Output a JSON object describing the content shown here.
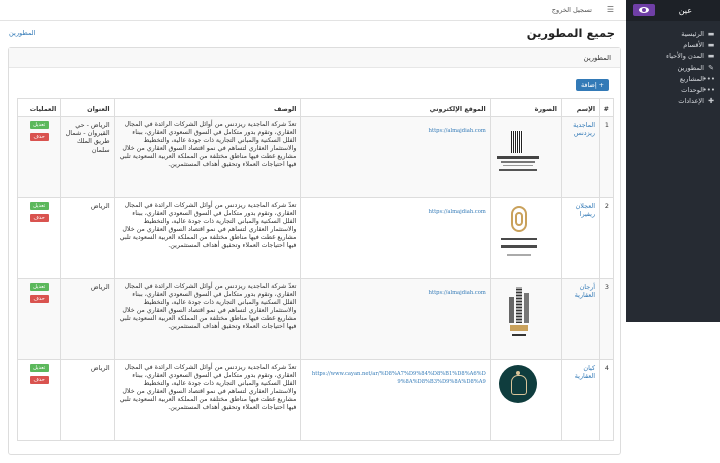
{
  "sidebar": {
    "title": "عين",
    "items": [
      {
        "label": "الرئيسية",
        "icon": "folder-icon"
      },
      {
        "label": "الأقسام",
        "icon": "folder-icon"
      },
      {
        "label": "المدن والأحياء",
        "icon": "folder-icon"
      },
      {
        "label": "المطورين",
        "icon": "pencil-icon"
      },
      {
        "label": "المشاريع",
        "icon": "dots-icon"
      },
      {
        "label": "الوحدات",
        "icon": "dots-icon"
      },
      {
        "label": "الإعدادات",
        "icon": "wrench-icon"
      }
    ]
  },
  "topbar": {
    "logout": "تسجيل الخروج",
    "menu_icon": "hamburger-icon"
  },
  "breadcrumb": "المطورين",
  "page_title": "جميع المطورين",
  "card": {
    "title": "المطورين",
    "add_button": "إضافة"
  },
  "table": {
    "headers": [
      "#",
      "الإسم",
      "الصورة",
      "الموقع الإلكتروني",
      "الوصف",
      "العنوان",
      "العمليات"
    ],
    "rows": [
      {
        "num": "1",
        "name": "الماجدية ريزدنس",
        "website": "https://almajdiah.com",
        "description": "تعدّ شركة الماجدية ريزدنس من أوائل الشركات الرائدة في المجال العقاري، وتقوم بدور متكامل في السوق السعودي العقاري، ببناء الفلل السكنية والمباني التجارية ذات جودة عالية، والتخطيط والاستثمار العقاري لتساهم في نمو اقتصاد السوق العقاري من خلال مشاريع غطت فيها مناطق مختلفة من المملكة العربية السعودية تلبي فيها احتياجات العملاء وتحقيق أهداف المستثمرين.",
        "address": "الرياض - حي القيروان - شمال طريق الملك سلمان",
        "edit": "تعديل",
        "delete": "حذف"
      },
      {
        "num": "2",
        "name": "العجلان ريفيرا",
        "website": "https://almajdiah.com",
        "description": "تعدّ شركة الماجدية ريزدنس من أوائل الشركات الرائدة في المجال العقاري، وتقوم بدور متكامل في السوق السعودي العقاري، ببناء الفلل السكنية والمباني التجارية ذات جودة عالية، والتخطيط والاستثمار العقاري لتساهم في نمو اقتصاد السوق العقاري من خلال مشاريع غطت فيها مناطق مختلفة من المملكة العربية السعودية تلبي فيها احتياجات العملاء وتحقيق أهداف المستثمرين.",
        "address": "الرياض",
        "edit": "تعديل",
        "delete": "حذف"
      },
      {
        "num": "3",
        "name": "أرجان العقارية",
        "website": "https://almajdiah.com",
        "description": "تعدّ شركة الماجدية ريزدنس من أوائل الشركات الرائدة في المجال العقاري، وتقوم بدور متكامل في السوق السعودي العقاري، ببناء الفلل السكنية والمباني التجارية ذات جودة عالية، والتخطيط والاستثمار العقاري لتساهم في نمو اقتصاد السوق العقاري من خلال مشاريع غطت فيها مناطق مختلفة من المملكة العربية السعودية تلبي فيها احتياجات العملاء وتحقيق أهداف المستثمرين.",
        "address": "الرياض",
        "edit": "تعديل",
        "delete": "حذف"
      },
      {
        "num": "4",
        "name": "كيان العقارية",
        "website": "https://www.cayan.net/ar/%D8%A7%D9%84%D8%B1%D8%A6%D9%8A%D8%B3%D9%8A%D8%A9",
        "description": "تعدّ شركة الماجدية ريزدنس من أوائل الشركات الرائدة في المجال العقاري، وتقوم بدور متكامل في السوق السعودي العقاري، ببناء الفلل السكنية والمباني التجارية ذات جودة عالية، والتخطيط والاستثمار العقاري لتساهم في نمو اقتصاد السوق العقاري من خلال مشاريع غطت فيها مناطق مختلفة من المملكة العربية السعودية تلبي فيها احتياجات العملاء وتحقيق أهداف المستثمرين.",
        "address": "الرياض",
        "edit": "تعديل",
        "delete": "حذف"
      }
    ]
  },
  "colors": {
    "sidebar_bg": "#262b33",
    "brand": "#6f3fa6",
    "primary": "#337ab7",
    "success": "#5cb85c",
    "danger": "#d9534f"
  }
}
